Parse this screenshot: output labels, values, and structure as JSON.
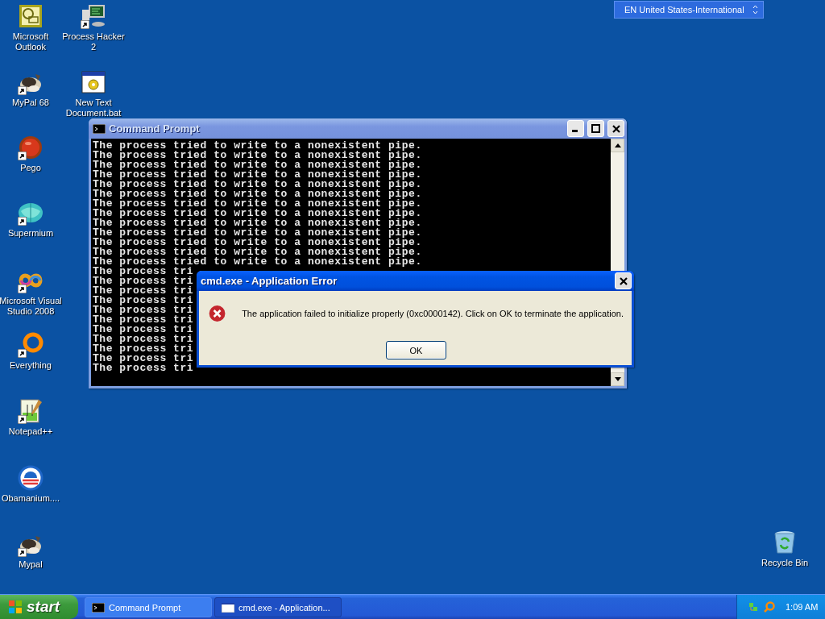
{
  "language_bar": {
    "label": "EN United States-International"
  },
  "desktop_icons": [
    {
      "label": "Microsoft Outlook",
      "kind": "outlook",
      "shortcut": false
    },
    {
      "label": "Process Hacker 2",
      "kind": "monitor",
      "shortcut": true
    },
    {
      "label": "MyPal 68",
      "kind": "animal",
      "shortcut": true
    },
    {
      "label": "New Text Document.bat",
      "kind": "batch",
      "shortcut": false
    },
    {
      "label": "Pego",
      "kind": "ball",
      "shortcut": true
    },
    {
      "label": "Supermium",
      "kind": "globe",
      "shortcut": true
    },
    {
      "label": "Microsoft Visual Studio 2008",
      "kind": "infinity",
      "shortcut": true
    },
    {
      "label": "Everything",
      "kind": "ring",
      "shortcut": true
    },
    {
      "label": "Notepad++",
      "kind": "notepad",
      "shortcut": true
    },
    {
      "label": "Obamanium....",
      "kind": "stripes",
      "shortcut": false
    },
    {
      "label": "Mypal",
      "kind": "animal",
      "shortcut": true
    },
    {
      "label": "Recycle Bin",
      "kind": "recycle",
      "shortcut": false
    }
  ],
  "command_prompt": {
    "title": "Command Prompt",
    "active": false,
    "lines": [
      "The process tried to write to a nonexistent pipe.",
      "The process tried to write to a nonexistent pipe.",
      "The process tried to write to a nonexistent pipe.",
      "The process tried to write to a nonexistent pipe.",
      "The process tried to write to a nonexistent pipe.",
      "The process tried to write to a nonexistent pipe.",
      "The process tried to write to a nonexistent pipe.",
      "The process tried to write to a nonexistent pipe.",
      "The process tried to write to a nonexistent pipe.",
      "The process tried to write to a nonexistent pipe.",
      "The process tried to write to a nonexistent pipe.",
      "The process tried to write to a nonexistent pipe.",
      "The process tried to write to a nonexistent pipe.",
      "The process tri",
      "The process tri",
      "The process tri",
      "The process tri",
      "The process tri",
      "The process tri",
      "The process tri",
      "The process tri",
      "The process tri",
      "The process tri",
      "The process tri"
    ]
  },
  "error_dialog": {
    "title": "cmd.exe - Application Error",
    "active": true,
    "message": "The application failed to initialize properly (0xc0000142). Click on OK to terminate the application.",
    "buttons": [
      {
        "label": "OK"
      }
    ]
  },
  "taskbar": {
    "start_label": "start",
    "tasks": [
      {
        "label": "Command Prompt",
        "kind": "console",
        "selected": false
      },
      {
        "label": "cmd.exe - Application...",
        "kind": "window",
        "selected": true
      }
    ],
    "clock": "1:09 AM"
  }
}
